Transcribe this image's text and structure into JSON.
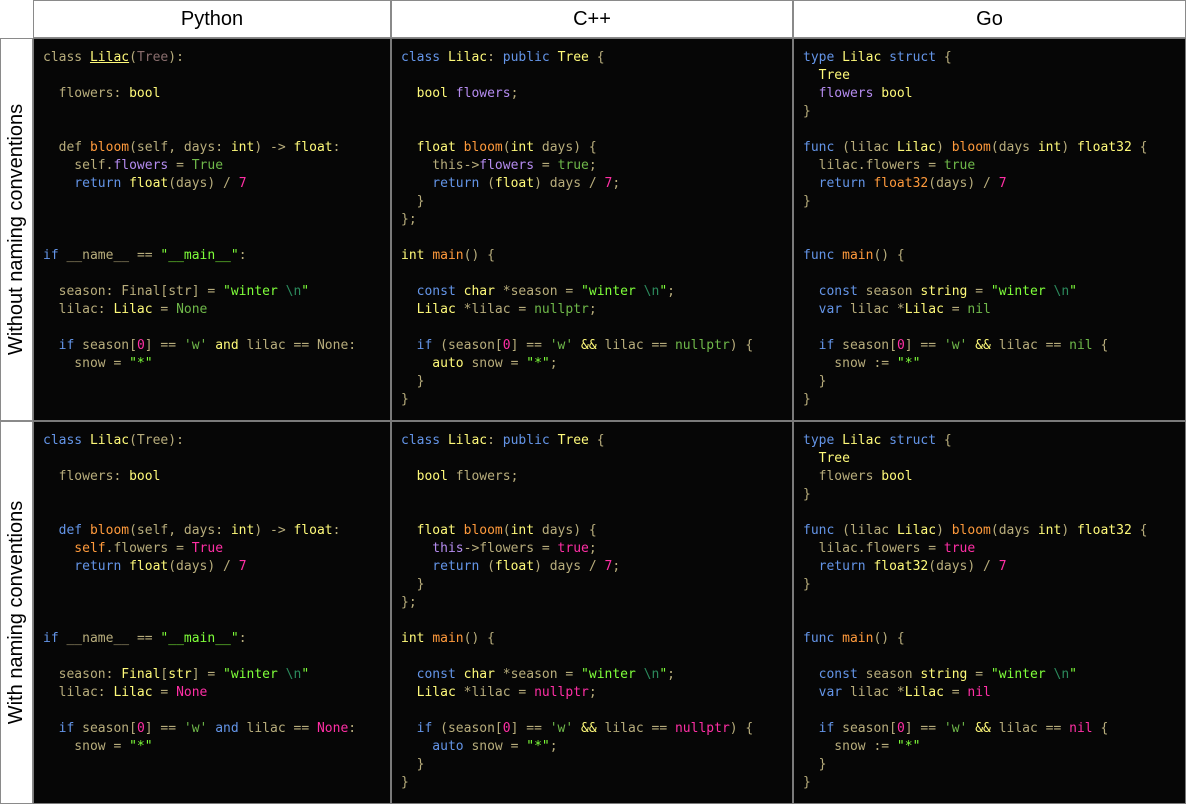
{
  "headers": {
    "corner": "",
    "python": "Python",
    "cpp": "C++",
    "go": "Go"
  },
  "row_labels": {
    "row1": "Without naming conventions",
    "row2": "With naming conventions"
  },
  "colors": {
    "default": "#b8ad7c",
    "kw": "#6495e8",
    "ty": "#fffa7a",
    "fn": "#ff9a3c",
    "pink": "#ff2fa5",
    "str": "#7fff3a",
    "cmt": "#2b8a5c",
    "purple": "#b58cf0",
    "grn": "#6fb84a",
    "dim": "#8a6e6e",
    "white": "#d8d0b0"
  },
  "cells": {
    "py1": [
      [
        [
          "class ",
          "d"
        ],
        [
          "Lilac",
          "tyu"
        ],
        [
          "(",
          "d"
        ],
        [
          "Tree",
          "dim"
        ],
        "):"
      ],
      [],
      [
        [
          "  flowers: ",
          "d"
        ],
        [
          "bool",
          "ty"
        ]
      ],
      [],
      [],
      [
        [
          "  def ",
          "d"
        ],
        [
          "bloom",
          "fn"
        ],
        [
          "(self, days: ",
          "d"
        ],
        [
          "int",
          "ty"
        ],
        [
          ") -> ",
          "d"
        ],
        [
          "float",
          "ty"
        ],
        [
          ":",
          "d"
        ]
      ],
      [
        [
          "    self.",
          "d"
        ],
        [
          "flowers",
          "pur"
        ],
        [
          " = ",
          "d"
        ],
        [
          "True",
          "grn"
        ]
      ],
      [
        [
          "    return ",
          "kw"
        ],
        [
          "float",
          "ty"
        ],
        [
          "(days) / ",
          "d"
        ],
        [
          "7",
          "pink"
        ]
      ],
      [],
      [],
      [],
      [
        [
          "if ",
          "kw"
        ],
        [
          "__name__ ",
          "d"
        ],
        [
          "== ",
          "d"
        ],
        [
          "\"__main__\"",
          "str"
        ],
        [
          ":",
          "d"
        ]
      ],
      [],
      [
        [
          "  season: Final[str] = ",
          "d"
        ],
        [
          "\"winter ",
          "str"
        ],
        [
          "\\n",
          "cmt"
        ],
        [
          "\"",
          "str"
        ]
      ],
      [
        [
          "  lilac: ",
          "d"
        ],
        [
          "Lilac",
          "ty"
        ],
        [
          " = ",
          "d"
        ],
        [
          "None",
          "grn"
        ]
      ],
      [],
      [
        [
          "  if ",
          "kw"
        ],
        [
          "season[",
          "d"
        ],
        [
          "0",
          "pink"
        ],
        [
          "] == ",
          "d"
        ],
        [
          "'w'",
          "grn"
        ],
        [
          " and ",
          "ty"
        ],
        [
          "lilac == None:",
          "d"
        ]
      ],
      [
        [
          "    snow = ",
          "d"
        ],
        [
          "\"*\"",
          "str"
        ]
      ]
    ],
    "cpp1": [
      [
        [
          "class ",
          "kw"
        ],
        [
          "Lilac",
          "ty"
        ],
        [
          ": ",
          "d"
        ],
        [
          "public ",
          "kw"
        ],
        [
          "Tree",
          "ty"
        ],
        [
          " {",
          "d"
        ]
      ],
      [],
      [
        [
          "  bool ",
          "ty"
        ],
        [
          "flowers",
          "pur"
        ],
        [
          ";",
          "d"
        ]
      ],
      [],
      [],
      [
        [
          "  float ",
          "ty"
        ],
        [
          "bloom",
          "fn"
        ],
        [
          "(",
          "d"
        ],
        [
          "int ",
          "ty"
        ],
        [
          "days) {",
          "d"
        ]
      ],
      [
        [
          "    this->",
          "d"
        ],
        [
          "flowers",
          "pur"
        ],
        [
          " = ",
          "d"
        ],
        [
          "true",
          "grn"
        ],
        [
          ";",
          "d"
        ]
      ],
      [
        [
          "    return ",
          "kw"
        ],
        [
          "(",
          "d"
        ],
        [
          "float",
          "ty"
        ],
        [
          ") days / ",
          "d"
        ],
        [
          "7",
          "pink"
        ],
        [
          ";",
          "d"
        ]
      ],
      [
        [
          "  }",
          "d"
        ]
      ],
      [
        [
          "};",
          "d"
        ]
      ],
      [],
      [
        [
          "int ",
          "ty"
        ],
        [
          "main",
          "fn"
        ],
        [
          "() {",
          "d"
        ]
      ],
      [],
      [
        [
          "  const ",
          "kw"
        ],
        [
          "char ",
          "ty"
        ],
        [
          "*season = ",
          "d"
        ],
        [
          "\"winter ",
          "str"
        ],
        [
          "\\n",
          "cmt"
        ],
        [
          "\"",
          "str"
        ],
        [
          ";",
          "d"
        ]
      ],
      [
        [
          "  Lilac ",
          "ty"
        ],
        [
          "*lilac = ",
          "d"
        ],
        [
          "nullptr",
          "grn"
        ],
        [
          ";",
          "d"
        ]
      ],
      [],
      [
        [
          "  if ",
          "kw"
        ],
        [
          "(season[",
          "d"
        ],
        [
          "0",
          "pink"
        ],
        [
          "] == ",
          "d"
        ],
        [
          "'w'",
          "grn"
        ],
        [
          " && ",
          "ty"
        ],
        [
          "lilac == ",
          "d"
        ],
        [
          "nullptr",
          "grn"
        ],
        [
          ") {",
          "d"
        ]
      ],
      [
        [
          "    auto ",
          "ty"
        ],
        [
          "snow = ",
          "d"
        ],
        [
          "\"*\"",
          "str"
        ],
        [
          ";",
          "d"
        ]
      ],
      [
        [
          "  }",
          "d"
        ]
      ],
      [
        [
          "}",
          "d"
        ]
      ]
    ],
    "go1": [
      [
        [
          "type ",
          "kw"
        ],
        [
          "Lilac ",
          "ty"
        ],
        [
          "struct ",
          "kw"
        ],
        [
          "{",
          "d"
        ]
      ],
      [
        [
          "  Tree",
          "ty"
        ]
      ],
      [
        [
          "  flowers ",
          "pur"
        ],
        [
          "bool",
          "ty"
        ]
      ],
      [
        [
          "}",
          "d"
        ]
      ],
      [],
      [
        [
          "func ",
          "kw"
        ],
        [
          "(lilac ",
          "d"
        ],
        [
          "Lilac",
          "ty"
        ],
        [
          ") ",
          "d"
        ],
        [
          "bloom",
          "fn"
        ],
        [
          "(days ",
          "d"
        ],
        [
          "int",
          "ty"
        ],
        [
          ") ",
          "d"
        ],
        [
          "float32 ",
          "ty"
        ],
        [
          "{",
          "d"
        ]
      ],
      [
        [
          "  lilac.flowers = ",
          "d"
        ],
        [
          "true",
          "grn"
        ]
      ],
      [
        [
          "  return ",
          "kw"
        ],
        [
          "float32",
          "fn"
        ],
        [
          "(days) / ",
          "d"
        ],
        [
          "7",
          "pink"
        ]
      ],
      [
        [
          "}",
          "d"
        ]
      ],
      [],
      [],
      [
        [
          "func ",
          "kw"
        ],
        [
          "main",
          "fn"
        ],
        [
          "() {",
          "d"
        ]
      ],
      [],
      [
        [
          "  const ",
          "kw"
        ],
        [
          "season ",
          "d"
        ],
        [
          "string ",
          "ty"
        ],
        [
          "= ",
          "d"
        ],
        [
          "\"winter ",
          "str"
        ],
        [
          "\\n",
          "cmt"
        ],
        [
          "\"",
          "str"
        ]
      ],
      [
        [
          "  var ",
          "kw"
        ],
        [
          "lilac *",
          "d"
        ],
        [
          "Lilac",
          "ty"
        ],
        [
          " = ",
          "d"
        ],
        [
          "nil",
          "grn"
        ]
      ],
      [],
      [
        [
          "  if ",
          "kw"
        ],
        [
          "season[",
          "d"
        ],
        [
          "0",
          "pink"
        ],
        [
          "] == ",
          "d"
        ],
        [
          "'w'",
          "grn"
        ],
        [
          " && ",
          "ty"
        ],
        [
          "lilac == ",
          "d"
        ],
        [
          "nil ",
          "grn"
        ],
        [
          "{",
          "d"
        ]
      ],
      [
        [
          "    snow := ",
          "d"
        ],
        [
          "\"*\"",
          "str"
        ]
      ],
      [
        [
          "  }",
          "d"
        ]
      ],
      [
        [
          "}",
          "d"
        ]
      ]
    ],
    "py2": [
      [
        [
          "class ",
          "kw"
        ],
        [
          "Lilac",
          "ty"
        ],
        [
          "(Tree):",
          "d"
        ]
      ],
      [],
      [
        [
          "  flowers: ",
          "d"
        ],
        [
          "bool",
          "ty"
        ]
      ],
      [],
      [],
      [
        [
          "  def ",
          "kw"
        ],
        [
          "bloom",
          "fn"
        ],
        [
          "(self, days: ",
          "d"
        ],
        [
          "int",
          "ty"
        ],
        [
          ") -> ",
          "d"
        ],
        [
          "float",
          "ty"
        ],
        [
          ":",
          "d"
        ]
      ],
      [
        [
          "    self",
          "fn"
        ],
        [
          ".flowers = ",
          "d"
        ],
        [
          "True",
          "pink"
        ]
      ],
      [
        [
          "    return ",
          "kw"
        ],
        [
          "float",
          "ty"
        ],
        [
          "(days) / ",
          "d"
        ],
        [
          "7",
          "pink"
        ]
      ],
      [],
      [],
      [],
      [
        [
          "if ",
          "kw"
        ],
        [
          "__name__ ",
          "d"
        ],
        [
          "== ",
          "d"
        ],
        [
          "\"__main__\"",
          "str"
        ],
        [
          ":",
          "d"
        ]
      ],
      [],
      [
        [
          "  season: ",
          "d"
        ],
        [
          "Final",
          "ty"
        ],
        [
          "[",
          "d"
        ],
        [
          "str",
          "ty"
        ],
        [
          "] = ",
          "d"
        ],
        [
          "\"winter ",
          "str"
        ],
        [
          "\\n",
          "cmt"
        ],
        [
          "\"",
          "str"
        ]
      ],
      [
        [
          "  lilac: ",
          "d"
        ],
        [
          "Lilac",
          "ty"
        ],
        [
          " = ",
          "d"
        ],
        [
          "None",
          "pink"
        ]
      ],
      [],
      [
        [
          "  if ",
          "kw"
        ],
        [
          "season[",
          "d"
        ],
        [
          "0",
          "pink"
        ],
        [
          "] == ",
          "d"
        ],
        [
          "'w'",
          "grn"
        ],
        [
          " and ",
          "kw"
        ],
        [
          "lilac == ",
          "d"
        ],
        [
          "None",
          "pink"
        ],
        [
          ":",
          "d"
        ]
      ],
      [
        [
          "    snow = ",
          "d"
        ],
        [
          "\"*\"",
          "str"
        ]
      ]
    ],
    "cpp2": [
      [
        [
          "class ",
          "kw"
        ],
        [
          "Lilac",
          "ty"
        ],
        [
          ": ",
          "d"
        ],
        [
          "public ",
          "kw"
        ],
        [
          "Tree",
          "ty"
        ],
        [
          " {",
          "d"
        ]
      ],
      [],
      [
        [
          "  bool ",
          "ty"
        ],
        [
          "flowers;",
          "d"
        ]
      ],
      [],
      [],
      [
        [
          "  float ",
          "ty"
        ],
        [
          "bloom",
          "fn"
        ],
        [
          "(",
          "d"
        ],
        [
          "int ",
          "ty"
        ],
        [
          "days) {",
          "d"
        ]
      ],
      [
        [
          "    this",
          "pur"
        ],
        [
          "->flowers = ",
          "d"
        ],
        [
          "true",
          "pink"
        ],
        [
          ";",
          "d"
        ]
      ],
      [
        [
          "    return ",
          "kw"
        ],
        [
          "(",
          "d"
        ],
        [
          "float",
          "ty"
        ],
        [
          ") days / ",
          "d"
        ],
        [
          "7",
          "pink"
        ],
        [
          ";",
          "d"
        ]
      ],
      [
        [
          "  }",
          "d"
        ]
      ],
      [
        [
          "};",
          "d"
        ]
      ],
      [],
      [
        [
          "int ",
          "ty"
        ],
        [
          "main",
          "fn"
        ],
        [
          "() {",
          "d"
        ]
      ],
      [],
      [
        [
          "  const ",
          "kw"
        ],
        [
          "char ",
          "ty"
        ],
        [
          "*season = ",
          "d"
        ],
        [
          "\"winter ",
          "str"
        ],
        [
          "\\n",
          "cmt"
        ],
        [
          "\"",
          "str"
        ],
        [
          ";",
          "d"
        ]
      ],
      [
        [
          "  Lilac ",
          "ty"
        ],
        [
          "*lilac = ",
          "d"
        ],
        [
          "nullptr",
          "pink"
        ],
        [
          ";",
          "d"
        ]
      ],
      [],
      [
        [
          "  if ",
          "kw"
        ],
        [
          "(season[",
          "d"
        ],
        [
          "0",
          "pink"
        ],
        [
          "] == ",
          "d"
        ],
        [
          "'w'",
          "grn"
        ],
        [
          " && ",
          "ty"
        ],
        [
          "lilac == ",
          "d"
        ],
        [
          "nullptr",
          "pink"
        ],
        [
          ") {",
          "d"
        ]
      ],
      [
        [
          "    auto ",
          "kw"
        ],
        [
          "snow = ",
          "d"
        ],
        [
          "\"*\"",
          "str"
        ],
        [
          ";",
          "d"
        ]
      ],
      [
        [
          "  }",
          "d"
        ]
      ],
      [
        [
          "}",
          "d"
        ]
      ]
    ],
    "go2": [
      [
        [
          "type ",
          "kw"
        ],
        [
          "Lilac ",
          "ty"
        ],
        [
          "struct ",
          "kw"
        ],
        [
          "{",
          "d"
        ]
      ],
      [
        [
          "  Tree",
          "ty"
        ]
      ],
      [
        [
          "  flowers ",
          "d"
        ],
        [
          "bool",
          "ty"
        ]
      ],
      [
        [
          "}",
          "d"
        ]
      ],
      [],
      [
        [
          "func ",
          "kw"
        ],
        [
          "(lilac ",
          "d"
        ],
        [
          "Lilac",
          "ty"
        ],
        [
          ") ",
          "d"
        ],
        [
          "bloom",
          "fn"
        ],
        [
          "(days ",
          "d"
        ],
        [
          "int",
          "ty"
        ],
        [
          ") ",
          "d"
        ],
        [
          "float32 ",
          "ty"
        ],
        [
          "{",
          "d"
        ]
      ],
      [
        [
          "  lilac.flowers = ",
          "d"
        ],
        [
          "true",
          "pink"
        ]
      ],
      [
        [
          "  return ",
          "kw"
        ],
        [
          "float32",
          "ty"
        ],
        [
          "(days) / ",
          "d"
        ],
        [
          "7",
          "pink"
        ]
      ],
      [
        [
          "}",
          "d"
        ]
      ],
      [],
      [],
      [
        [
          "func ",
          "kw"
        ],
        [
          "main",
          "fn"
        ],
        [
          "() {",
          "d"
        ]
      ],
      [],
      [
        [
          "  const ",
          "kw"
        ],
        [
          "season ",
          "d"
        ],
        [
          "string ",
          "ty"
        ],
        [
          "= ",
          "d"
        ],
        [
          "\"winter ",
          "str"
        ],
        [
          "\\n",
          "cmt"
        ],
        [
          "\"",
          "str"
        ]
      ],
      [
        [
          "  var ",
          "kw"
        ],
        [
          "lilac *",
          "d"
        ],
        [
          "Lilac",
          "ty"
        ],
        [
          " = ",
          "d"
        ],
        [
          "nil",
          "pink"
        ]
      ],
      [],
      [
        [
          "  if ",
          "kw"
        ],
        [
          "season[",
          "d"
        ],
        [
          "0",
          "pink"
        ],
        [
          "] == ",
          "d"
        ],
        [
          "'w'",
          "grn"
        ],
        [
          " && ",
          "ty"
        ],
        [
          "lilac == ",
          "d"
        ],
        [
          "nil ",
          "pink"
        ],
        [
          "{",
          "d"
        ]
      ],
      [
        [
          "    snow := ",
          "d"
        ],
        [
          "\"*\"",
          "str"
        ]
      ],
      [
        [
          "  }",
          "d"
        ]
      ],
      [
        [
          "}",
          "d"
        ]
      ]
    ]
  }
}
